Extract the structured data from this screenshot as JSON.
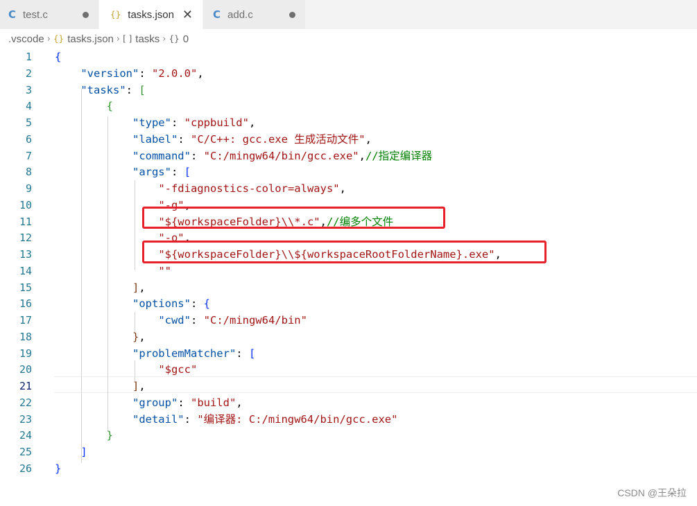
{
  "tabs": [
    {
      "icon": "C",
      "label": "test.c",
      "state": "dot"
    },
    {
      "icon": "{}",
      "label": "tasks.json",
      "state": "close"
    },
    {
      "icon": "C",
      "label": "add.c",
      "state": "dot"
    }
  ],
  "tab_close_glyph": "✕",
  "breadcrumb": {
    "folder": ".vscode",
    "file_icon": "{}",
    "file": "tasks.json",
    "array_icon": "[ ]",
    "array": "tasks",
    "object_icon": "{}",
    "object": "0",
    "separator": "›"
  },
  "editor": {
    "current_line": "21",
    "line_numbers": [
      "1",
      "2",
      "3",
      "4",
      "5",
      "6",
      "7",
      "8",
      "9",
      "10",
      "11",
      "12",
      "13",
      "14",
      "15",
      "16",
      "17",
      "18",
      "19",
      "20",
      "21",
      "22",
      "23",
      "24",
      "25",
      "26"
    ],
    "lines": [
      [
        "{"
      ],
      [
        "    ",
        "\"version\"",
        ": ",
        "\"2.0.0\"",
        ","
      ],
      [
        "    ",
        "\"tasks\"",
        ": ",
        "["
      ],
      [
        "        ",
        "{"
      ],
      [
        "            ",
        "\"type\"",
        ": ",
        "\"cppbuild\"",
        ","
      ],
      [
        "            ",
        "\"label\"",
        ": ",
        "\"C/C++: gcc.exe 生成活动文件\"",
        ","
      ],
      [
        "            ",
        "\"command\"",
        ": ",
        "\"C:/mingw64/bin/gcc.exe\"",
        ",",
        "//指定编译器"
      ],
      [
        "            ",
        "\"args\"",
        ": ",
        "["
      ],
      [
        "                ",
        "\"-fdiagnostics-color=always\"",
        ","
      ],
      [
        "                ",
        "\"-g\"",
        ","
      ],
      [
        "                ",
        "\"${workspaceFolder}\\\\*.c\"",
        ",",
        "//编多个文件"
      ],
      [
        "                ",
        "\"-o\"",
        ","
      ],
      [
        "                ",
        "\"${workspaceFolder}\\\\${workspaceRootFolderName}.exe\"",
        ","
      ],
      [
        "                ",
        "\"\""
      ],
      [
        "            ",
        "]",
        ","
      ],
      [
        "            ",
        "\"options\"",
        ": ",
        "{"
      ],
      [
        "                ",
        "\"cwd\"",
        ": ",
        "\"C:/mingw64/bin\""
      ],
      [
        "            ",
        "}",
        ","
      ],
      [
        "            ",
        "\"problemMatcher\"",
        ": ",
        "["
      ],
      [
        "                ",
        "\"$gcc\""
      ],
      [
        "            ",
        "]",
        ","
      ],
      [
        "            ",
        "\"group\"",
        ": ",
        "\"build\"",
        ","
      ],
      [
        "            ",
        "\"detail\"",
        ": ",
        "\"编译器: C:/mingw64/bin/gcc.exe\""
      ],
      [
        "        ",
        "}"
      ],
      [
        "    ",
        "]"
      ],
      [
        "}"
      ]
    ]
  },
  "watermark": "CSDN @王朵拉",
  "colors": {
    "key": "#0451a5",
    "string": "#a31515",
    "comment": "#008000",
    "highlight_box": "#e8202a",
    "line_number": "#237893"
  }
}
